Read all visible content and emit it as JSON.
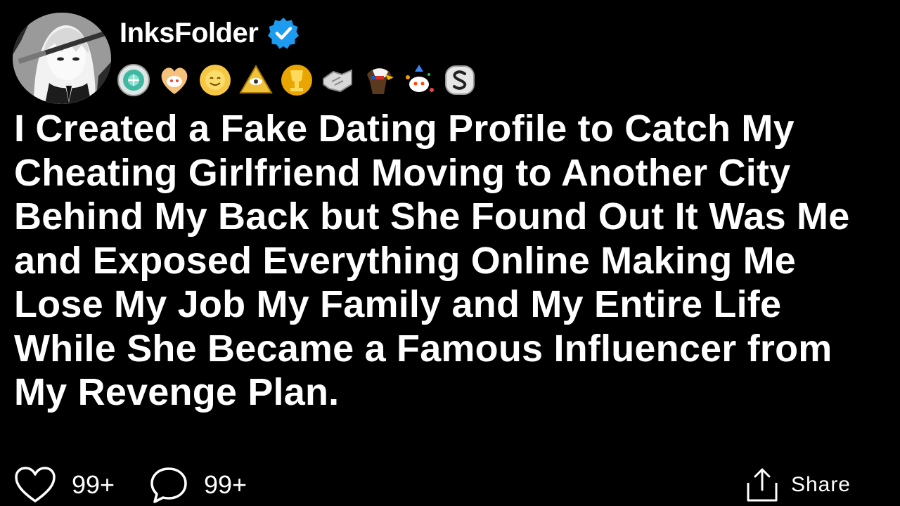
{
  "post": {
    "author": {
      "username": "InksFolder",
      "verified_icon": "verified-badge-icon",
      "avatar_icon": "anime-avatar-image"
    },
    "award_badges": [
      {
        "icon": "diamond-award-icon"
      },
      {
        "icon": "heart-snoo-award-icon"
      },
      {
        "icon": "sun-award-icon"
      },
      {
        "icon": "illuminati-pyramid-award-icon"
      },
      {
        "icon": "golden-trophy-award-icon"
      },
      {
        "icon": "handshake-award-icon"
      },
      {
        "icon": "eagle-award-icon"
      },
      {
        "icon": "snoo-party-award-icon"
      },
      {
        "icon": "silver-s-award-icon"
      }
    ],
    "title": "I Created a Fake Dating Profile to Catch My Cheating Girlfriend Moving to Another City Behind My Back but She Found Out It Was Me and Exposed Everything Online Making Me Lose My Job My Family and My Entire Life While She Became a Famous Influencer from My Revenge Plan."
  },
  "actions": {
    "likes": {
      "icon": "heart-icon",
      "count": "99+"
    },
    "comments": {
      "icon": "comment-bubble-icon",
      "count": "99+"
    },
    "share": {
      "icon": "share-icon",
      "label": "Share"
    }
  },
  "colors": {
    "background": "#000000",
    "text": "#ffffff",
    "verified_blue": "#1d9bf0"
  }
}
